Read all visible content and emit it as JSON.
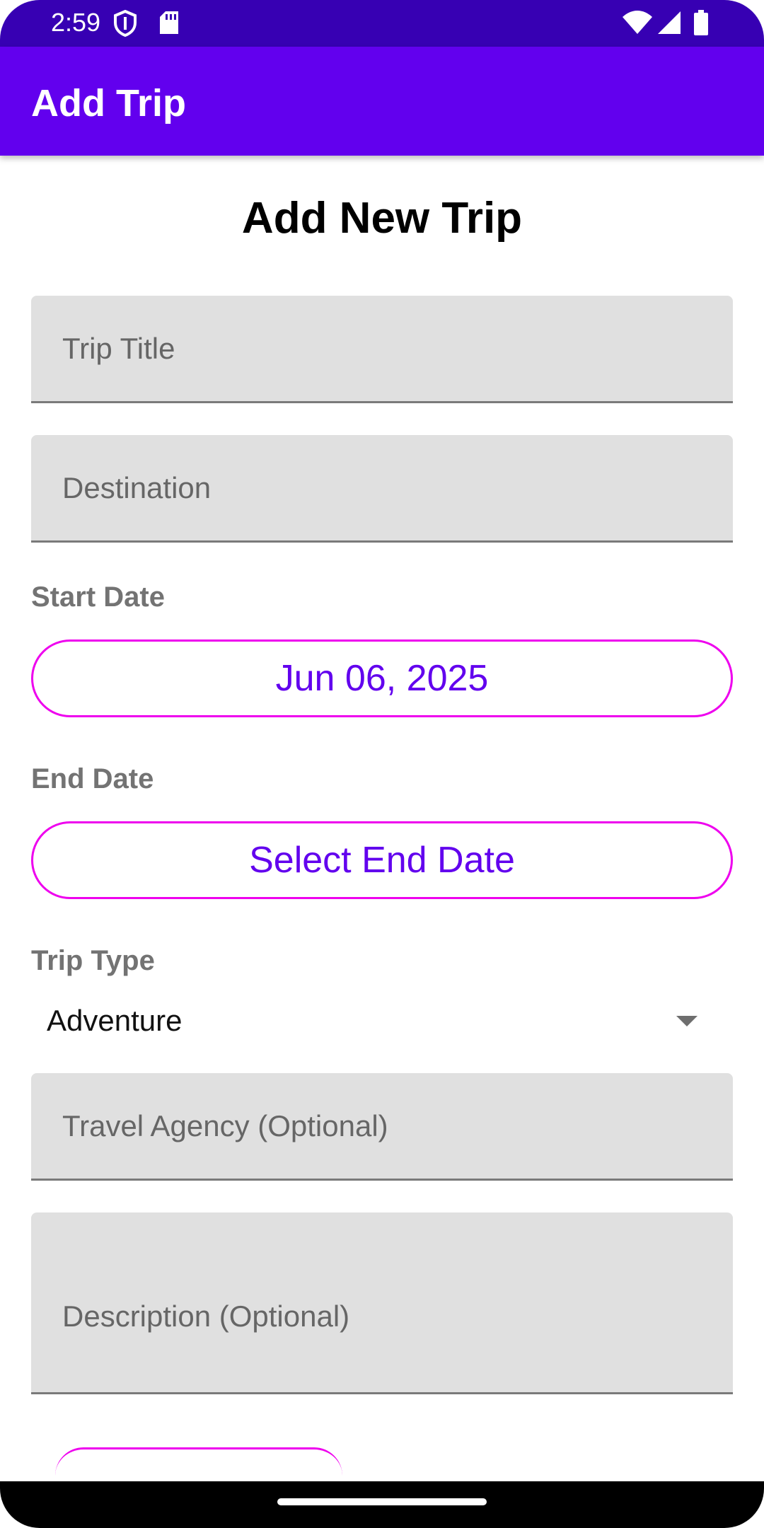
{
  "status_bar": {
    "time": "2:59",
    "icons": [
      "shield-icon",
      "sd-card-icon",
      "wifi-icon",
      "signal-icon",
      "battery-icon"
    ]
  },
  "app_bar": {
    "title": "Add Trip"
  },
  "form": {
    "heading": "Add New Trip",
    "trip_title": {
      "placeholder": "Trip Title",
      "value": ""
    },
    "destination": {
      "placeholder": "Destination",
      "value": ""
    },
    "start_date": {
      "label": "Start Date",
      "button_text": "Jun 06, 2025"
    },
    "end_date": {
      "label": "End Date",
      "button_text": "Select End Date"
    },
    "trip_type": {
      "label": "Trip Type",
      "selected": "Adventure"
    },
    "travel_agency": {
      "placeholder": "Travel Agency (Optional)",
      "value": ""
    },
    "description": {
      "placeholder": "Description (Optional)",
      "value": ""
    }
  },
  "colors": {
    "status_bar": "#3700b3",
    "app_bar": "#6200ee",
    "accent_text": "#6200ee",
    "button_outline": "#ee00ee",
    "field_background": "#e0e0e0"
  }
}
